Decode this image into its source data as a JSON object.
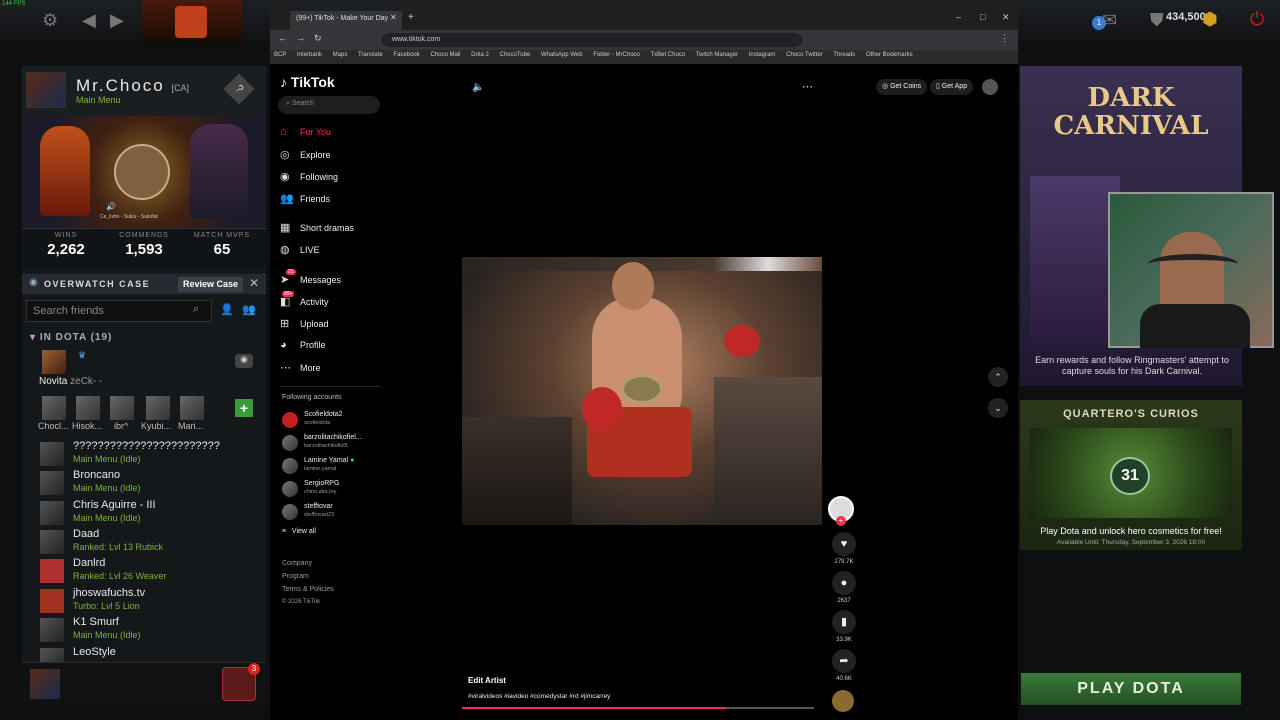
{
  "dota_top": {
    "fps": "144 FPS",
    "gold": "434,500",
    "notif_count": "1"
  },
  "profile": {
    "name": "Mr.Choco",
    "tag": "[CA]",
    "status": "Main Menu",
    "card_caption": "Ce_lixho - Sukiu - Sukofat"
  },
  "stats": [
    {
      "label": "WINS",
      "value": "2,262"
    },
    {
      "label": "COMMENDS",
      "value": "1,593"
    },
    {
      "label": "MATCH MVPS",
      "value": "65"
    }
  ],
  "overwatch": {
    "title": "OVERWATCH CASE",
    "button": "Review Case"
  },
  "friends_search": {
    "placeholder": "Search friends"
  },
  "in_dota": {
    "label": "IN DOTA (19)"
  },
  "party": [
    {
      "name": "Novita",
      "extra": "zeCk- -"
    }
  ],
  "party_row2": [
    "Chocl...",
    "Hisok...",
    "ibr^",
    "Kyubi...",
    "Mari..."
  ],
  "friends": [
    {
      "name": "????????????????????????",
      "status": "Main Menu (Idle)"
    },
    {
      "name": "Broncano",
      "status": "Main Menu (Idle)"
    },
    {
      "name": "Chris Aguirre - III",
      "status": "Main Menu (Idle)"
    },
    {
      "name": "Daad",
      "status": "Ranked: Lvl 13 Rubick"
    },
    {
      "name": "Danlrd",
      "status": "Ranked: Lvl 26 Weaver"
    },
    {
      "name": "jhoswafuchs.tv",
      "status": "Turbo: Lvl 5 Lion"
    },
    {
      "name": "K1 Smurf",
      "status": "Main Menu (Idle)"
    },
    {
      "name": "LeoStyle",
      "status": ""
    }
  ],
  "chat_badge": "3",
  "browser": {
    "tab_title": "(99+) TikTok - Make Your Day",
    "url": "www.tiktok.com",
    "bookmarks": [
      "BCP",
      "Interbank",
      "Maps",
      "Translate",
      "Facebook",
      "Choco Mail",
      "Dota 2",
      "ChocoTube",
      "WhatsApp Web",
      "Folder - MrChoco",
      "TxBet Choco",
      "Twitch Manager",
      "Instagram",
      "Choco Twitter",
      "Threads",
      "Other Bookmarks"
    ]
  },
  "tiktok": {
    "logo": "TikTok",
    "search_placeholder": "Search",
    "nav": [
      "For You",
      "Explore",
      "Following",
      "Friends",
      "Short dramas",
      "LIVE",
      "Messages",
      "Activity",
      "Upload",
      "Profile",
      "More"
    ],
    "messages_badge": "21",
    "activity_badge": "99+",
    "following_label": "Following accounts",
    "accounts": [
      {
        "name": "Scofieldota2",
        "handle": "scofieldota"
      },
      {
        "name": "barzolitachikofiel...",
        "handle": "barzolitachikofiel5"
      },
      {
        "name": "Lamine Yamal",
        "handle": "lamine.yamal"
      },
      {
        "name": "SergioRPG",
        "handle": "chino.aka.toy"
      },
      {
        "name": "stefftovar",
        "handle": "stefftovart23"
      }
    ],
    "view_all": "View all",
    "footer": [
      "Company",
      "Program",
      "Terms & Policies",
      "© 2026 TikTok"
    ],
    "get_coins": "Get Coins",
    "get_app": "Get App",
    "author": "Edit Artist",
    "caption": "#viralvideos #iavideo #comedystar #rd #jimcarrey",
    "counts": {
      "likes": "279.7K",
      "comments": "2637",
      "saves": "33.9K",
      "shares": "40.6K"
    },
    "progress": 0.75
  },
  "right": {
    "event_title": "DARK CARNIVAL",
    "event_desc": "Earn rewards and follow Ringmasters' attempt to capture souls for his Dark Carnival.",
    "curios_title": "QUARTERO'S CURIOS",
    "curios_count": "31",
    "curios_desc": "Play Dota and unlock hero cosmetics for free!",
    "curios_until": "Available Until: Thursday, September 3, 2026 18:00",
    "play_button": "PLAY DOTA"
  }
}
